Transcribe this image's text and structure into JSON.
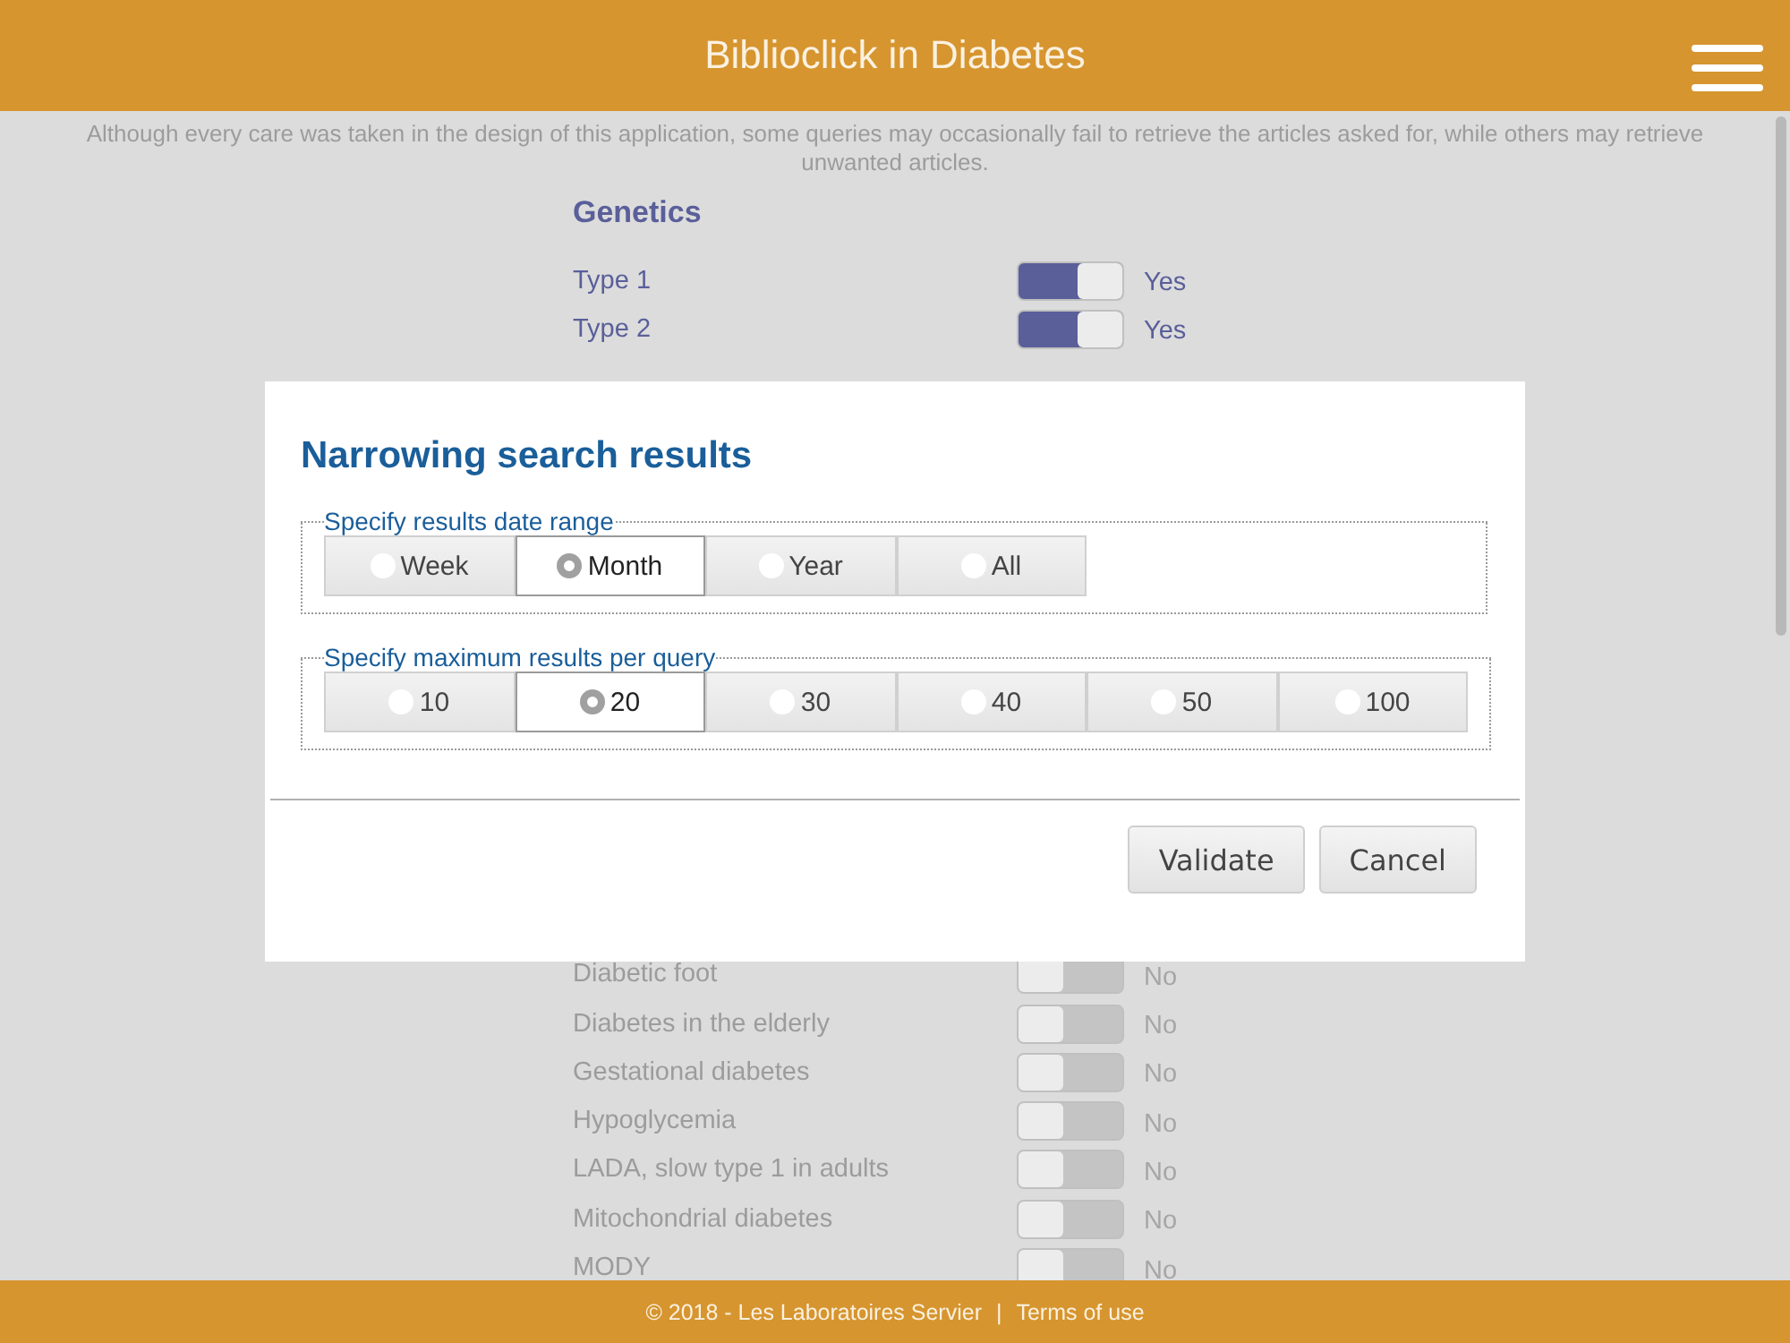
{
  "header": {
    "title": "Biblioclick in Diabetes"
  },
  "disclaimer": "Although every care was taken in the design of this application, some queries may occasionally fail to retrieve the articles asked for, while others may retrieve unwanted articles.",
  "section": {
    "heading": "Genetics",
    "items": [
      {
        "label": "Type 1",
        "on": true,
        "state_text": "Yes"
      },
      {
        "label": "Type 2",
        "on": true,
        "state_text": "Yes"
      }
    ]
  },
  "lower_items": [
    {
      "label": "Diabetic foot",
      "on": false,
      "state_text": "No"
    },
    {
      "label": "Diabetes in the elderly",
      "on": false,
      "state_text": "No"
    },
    {
      "label": "Gestational diabetes",
      "on": false,
      "state_text": "No"
    },
    {
      "label": "Hypoglycemia",
      "on": false,
      "state_text": "No"
    },
    {
      "label": "LADA, slow type 1 in adults",
      "on": false,
      "state_text": "No"
    },
    {
      "label": "Mitochondrial diabetes",
      "on": false,
      "state_text": "No"
    },
    {
      "label": "MODY",
      "on": false,
      "state_text": "No"
    }
  ],
  "dialog": {
    "title": "Narrowing search results",
    "groups": [
      {
        "legend": "Specify results date range",
        "options": [
          {
            "label": "Week",
            "selected": false
          },
          {
            "label": "Month",
            "selected": true
          },
          {
            "label": "Year",
            "selected": false
          },
          {
            "label": "All",
            "selected": false
          }
        ]
      },
      {
        "legend": "Specify maximum results per query",
        "options": [
          {
            "label": "10",
            "selected": false
          },
          {
            "label": "20",
            "selected": true
          },
          {
            "label": "30",
            "selected": false
          },
          {
            "label": "40",
            "selected": false
          },
          {
            "label": "50",
            "selected": false
          },
          {
            "label": "100",
            "selected": false
          }
        ]
      }
    ],
    "buttons": [
      "Validate",
      "Cancel"
    ]
  },
  "footer": {
    "copyright": "© 2018 - Les Laboratoires Servier",
    "separator": "|",
    "link": "Terms of use"
  }
}
